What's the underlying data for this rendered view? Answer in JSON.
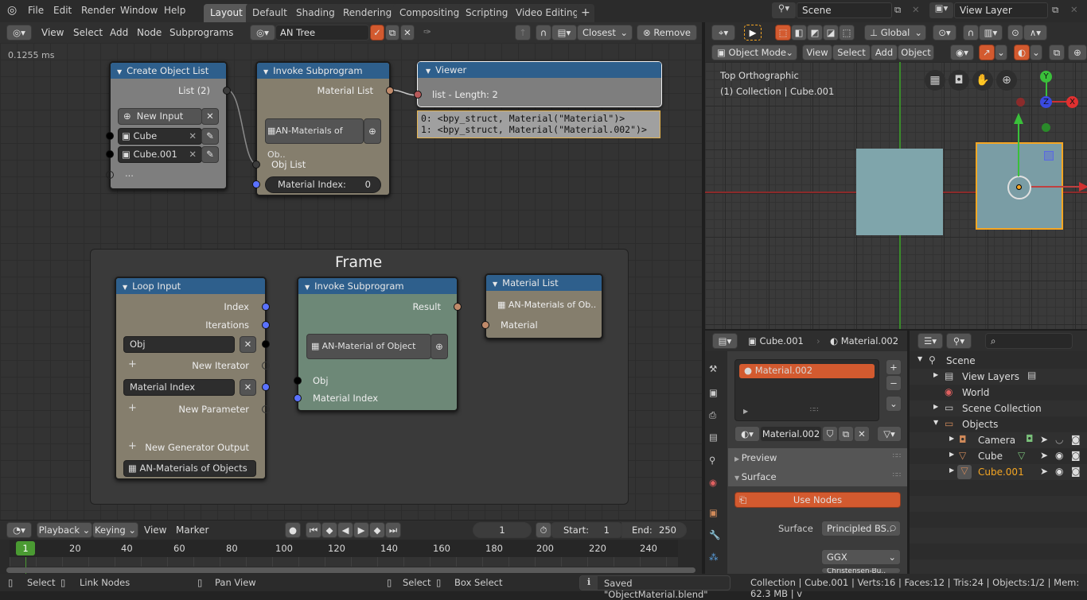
{
  "topbar": {
    "menus": [
      "File",
      "Edit",
      "Render",
      "Window",
      "Help"
    ],
    "workspaces": [
      {
        "label": "Layout",
        "active": true
      },
      {
        "label": "Default"
      },
      {
        "label": "Shading"
      },
      {
        "label": "Rendering"
      },
      {
        "label": "Compositing"
      },
      {
        "label": "Scripting"
      },
      {
        "label": "Video Editing"
      }
    ],
    "add_workspace_icon": "+",
    "scene": "Scene",
    "view_layer": "View Layer"
  },
  "node_header": {
    "menus": [
      "View",
      "Select",
      "Add",
      "Node",
      "Subprograms"
    ],
    "tree_name": "AN Tree",
    "snap_mode": "Closest",
    "remove_label": "Remove"
  },
  "node_editor": {
    "exec_time": "0.1255 ms",
    "create_object_list": {
      "title": "Create Object List",
      "output": "List (2)",
      "new_input": "New Input",
      "objects": [
        "Cube",
        "Cube.001"
      ],
      "more": "..."
    },
    "invoke_top": {
      "title": "Invoke Subprogram",
      "output": "Material List",
      "subprogram": "AN-Materials of Ob..",
      "input_list": "Obj List",
      "material_index_label": "Material Index:",
      "material_index_value": "0"
    },
    "viewer": {
      "title": "Viewer",
      "summary": "list - Length: 2",
      "lines": [
        "0: <bpy_struct, Material(\"Material\")>",
        "1: <bpy_struct, Material(\"Material.002\")>"
      ]
    },
    "frame": {
      "title": "Frame",
      "loop_input": {
        "title": "Loop Input",
        "outputs": [
          "Index",
          "Iterations"
        ],
        "iterator": "Obj",
        "new_iterator": "New Iterator",
        "parameter": "Material Index",
        "new_parameter": "New Parameter",
        "new_generator": "New Generator Output",
        "subprogram": "AN-Materials of Objects"
      },
      "invoke": {
        "title": "Invoke Subprogram",
        "output": "Result",
        "subprogram": "AN-Material of Object",
        "inputs": [
          "Obj",
          "Material Index"
        ]
      },
      "material_list": {
        "title": "Material List",
        "subprogram": "AN-Materials of Ob..",
        "input": "Material"
      }
    }
  },
  "viewport_header": {
    "transform_orientation": "Global",
    "mode": "Object Mode",
    "menus": [
      "View",
      "Select",
      "Add",
      "Object"
    ]
  },
  "viewport": {
    "view_name": "Top Orthographic",
    "collection_info": "(1) Collection | Cube.001",
    "gizmo_axes": [
      "Y",
      "Z",
      "X"
    ]
  },
  "properties": {
    "object": "Cube.001",
    "material": "Material.002",
    "slots": [
      "Material.002"
    ],
    "material_field": "Material.002",
    "panels": [
      {
        "label": "Preview",
        "open": false
      },
      {
        "label": "Surface",
        "open": true
      }
    ],
    "use_nodes": "Use Nodes",
    "surface_label": "Surface",
    "surface_value": "Principled BS..",
    "distribution": "GGX",
    "subsurface": "Christensen-Bu.."
  },
  "outliner": {
    "search_placeholder": "",
    "rows": [
      {
        "label": "Scene",
        "indent": 0
      },
      {
        "label": "View Layers",
        "indent": 1
      },
      {
        "label": "World",
        "indent": 1
      },
      {
        "label": "Scene Collection",
        "indent": 1
      },
      {
        "label": "Objects",
        "indent": 1
      },
      {
        "label": "Camera",
        "indent": 2
      },
      {
        "label": "Cube",
        "indent": 2
      },
      {
        "label": "Cube.001",
        "indent": 2,
        "active": true
      }
    ]
  },
  "timeline": {
    "menus": [
      "Playback",
      "Keying",
      "View",
      "Marker"
    ],
    "current_frame": "1",
    "start_label": "Start:",
    "start": "1",
    "end_label": "End:",
    "end": "250",
    "ticks": [
      "20",
      "40",
      "60",
      "80",
      "100",
      "120",
      "140",
      "160",
      "180",
      "200",
      "220",
      "240"
    ],
    "playhead": "1"
  },
  "status": {
    "hints": [
      {
        "label": "Select"
      },
      {
        "label": "Link Nodes"
      },
      {
        "label": "Pan View"
      },
      {
        "label": "Select"
      },
      {
        "label": "Box Select"
      }
    ],
    "message": "Saved \"ObjectMaterial.blend\"",
    "stats": "Collection | Cube.001 | Verts:16 | Faces:12 | Tris:24 | Objects:1/2 | Mem: 62.3 MB | v"
  },
  "colors": {
    "accent": "#d35a2f",
    "node_header": "#2e5f8c",
    "selection": "#f5a623"
  }
}
